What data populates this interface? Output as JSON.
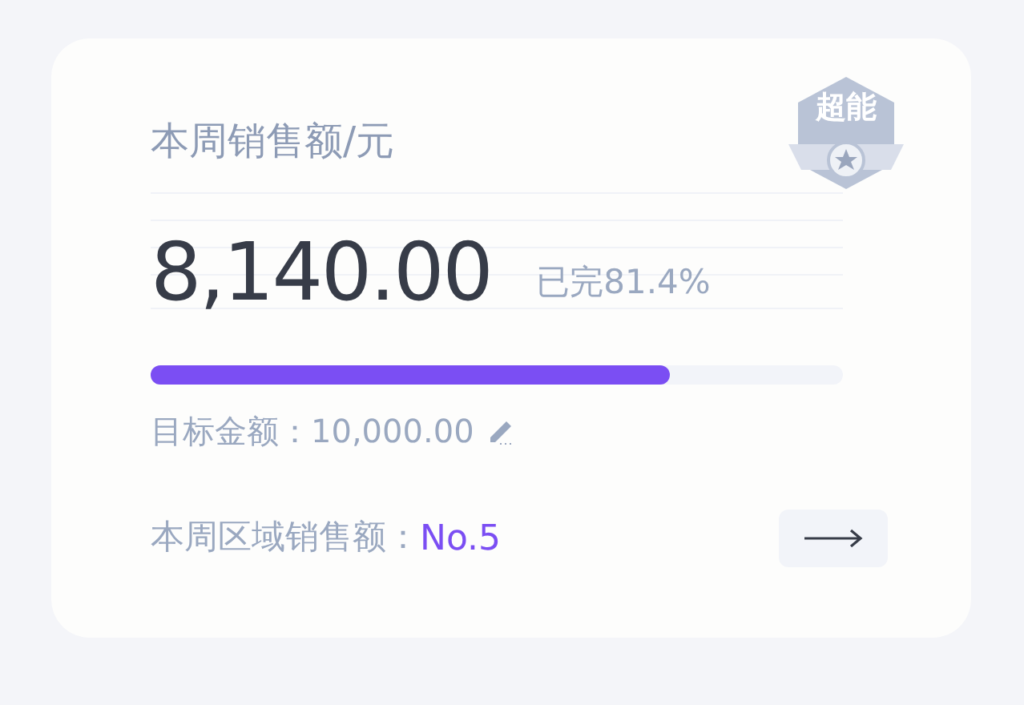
{
  "card": {
    "title": "本周销售额/元",
    "badge": "超能",
    "amount": "8,140.00",
    "completion": "已完81.4%",
    "progress": {
      "level": 0.75
    },
    "target_label": "目标金额：",
    "target_value": "10,000.00",
    "rank_label": "本周区域销售额：",
    "rank_value": "No.5"
  }
}
